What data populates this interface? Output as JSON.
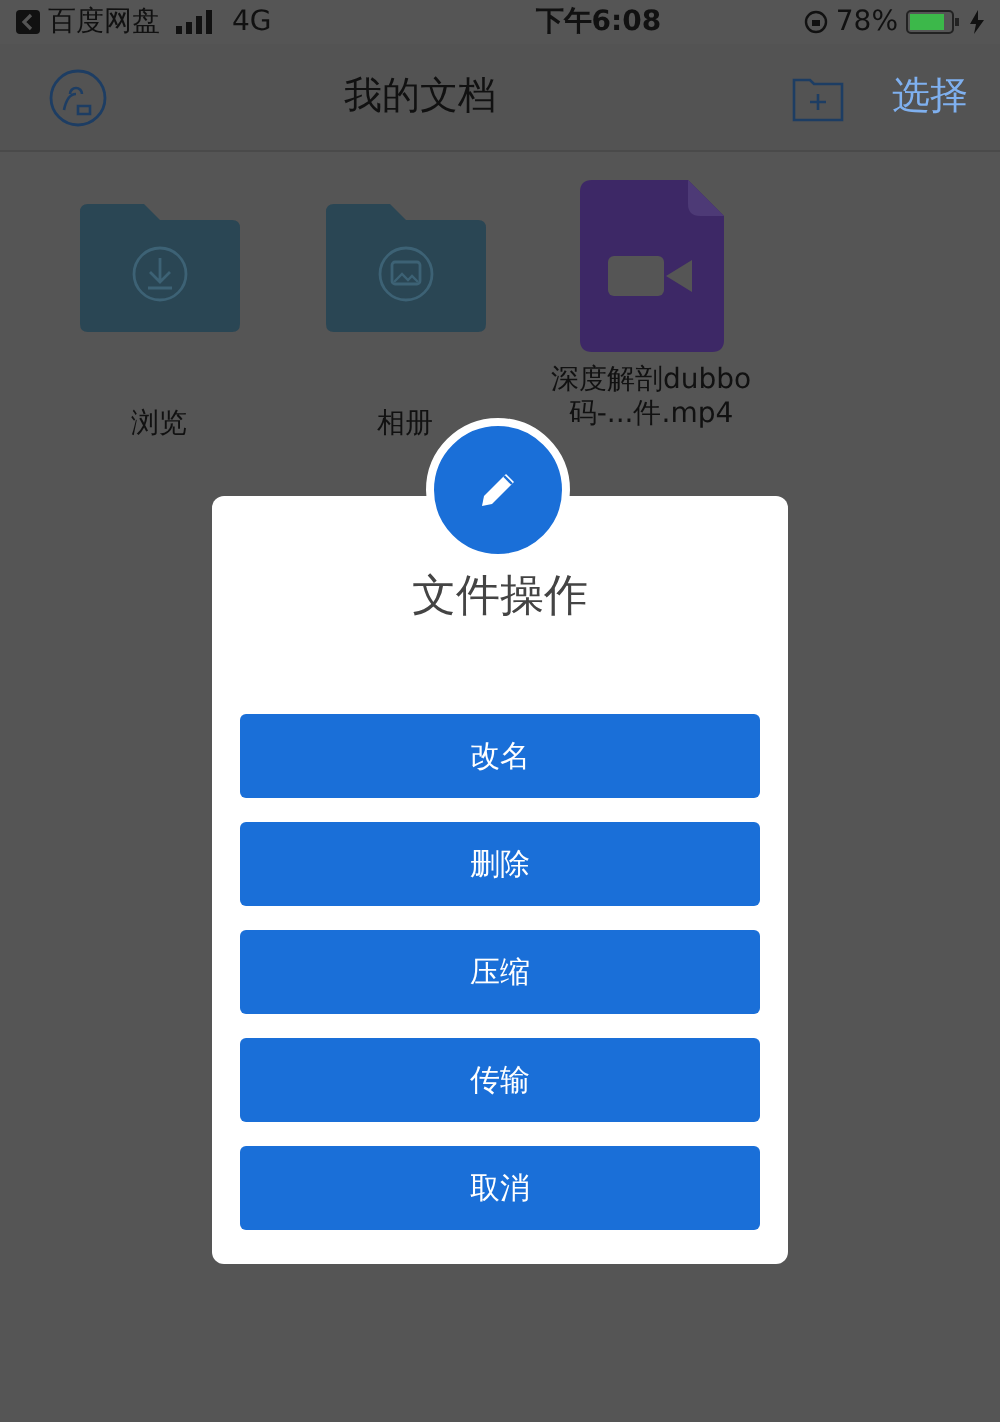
{
  "status_bar": {
    "back_app": "百度网盘",
    "network": "4G",
    "time": "下午6:08",
    "battery": "78%"
  },
  "nav_bar": {
    "title": "我的文档",
    "action": "选择"
  },
  "files": [
    {
      "kind": "download-folder",
      "lines": [
        "浏览"
      ]
    },
    {
      "kind": "image-folder",
      "lines": [
        "相册"
      ]
    },
    {
      "kind": "video",
      "lines": [
        "深度解剖dubbo",
        "码-...件.mp4"
      ]
    }
  ],
  "dialog": {
    "title": "文件操作",
    "buttons": [
      "改名",
      "删除",
      "压缩",
      "传输",
      "取消"
    ]
  }
}
